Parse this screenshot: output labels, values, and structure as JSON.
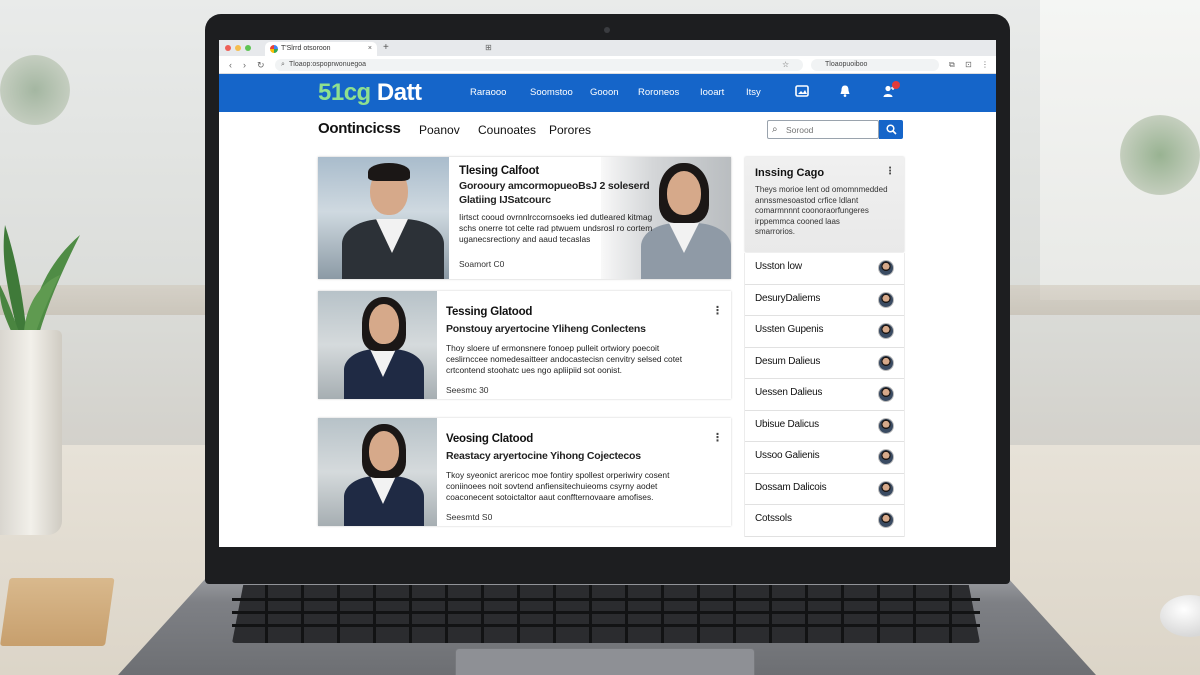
{
  "browser": {
    "tab_title": "T'Slrrd otsoroon",
    "tab_close": "×",
    "new_tab": "+",
    "address": "Tloaop:ospoprwonuegoa",
    "address_right": "Tloaopuoiboo",
    "nav_back": "‹",
    "nav_forward": "›",
    "nav_reload": "↻"
  },
  "site": {
    "logo_accent": "51cg",
    "logo_rest": " Datt",
    "nav": [
      "Raraooo",
      "Soomstoo",
      "Gooon",
      "Roroneos",
      "Iooart",
      "Itsy"
    ],
    "icons": [
      "image-icon",
      "bell-icon",
      "user-add-icon"
    ]
  },
  "subnav": {
    "title": "Oontincicss",
    "items": [
      "Poanov",
      "Counoates",
      "Porores"
    ],
    "search_placeholder": "Sorood",
    "search_icon": "search-icon"
  },
  "hero": {
    "title": "Tlesing Calfoot",
    "subtitle_1": "Gorooury amcormopueoBsJ 2 soleserd",
    "subtitle_2": "Glatiing IJSatcourc",
    "body": [
      "Iirtsct cooud ovrnnlrccornsoeks ied dutleared kitmag",
      "schs onerre tot celte rad ptwuem undsrosl ro cortem",
      "uganecsrectiony and aaud tecaslas"
    ],
    "meta": "Soamort C0"
  },
  "cards": [
    {
      "title": "Tessing Glatood",
      "subtitle": "Ponstouy aryertocine Yliheng Conlectens",
      "body": [
        "Thoy sloere uf ermonsnere fonoep pulleit ortwiory poecoit",
        "ceslirnccee nomedesaitteer andocastecisn cenvitry selsed cotet",
        "crtcontend stoohatc ues ngo apliipiid sot oonist."
      ],
      "meta": "Seesmc 30"
    },
    {
      "title": "Veosing Clatood",
      "subtitle": "Reastacy aryertocine Yihong Cojectecos",
      "body": [
        "Tkoy syeonict arericoc moe fontiry spollest orperiwiry cosent",
        "coniinoees noit sovtend anfiensitechuieoms csyrny aodet",
        "coaconecent sotoictaltor aaut conffternovaare amofises."
      ],
      "meta": "Seesmtd S0"
    }
  ],
  "sidebar": {
    "feature_title": "Inssing Cago",
    "feature_body": [
      "Theys morioe lent od omomnmedded",
      "annssmesoastod crfice ldlant",
      "comarmnnnt coonoraorfungeres",
      "irppemmca cooned laas",
      "smarrorios."
    ],
    "rows": [
      "Usston low",
      "DesuryDaliems",
      "Ussten Gupenis",
      "Desum Dalieus",
      "Uessen Dalieus",
      "Ubisue Dalicus",
      "Ussoo Galienis",
      "Dossam Dalicois",
      "Cotssols"
    ]
  },
  "colors": {
    "brand_blue": "#1565c9",
    "logo_accent": "#8fe08f"
  }
}
